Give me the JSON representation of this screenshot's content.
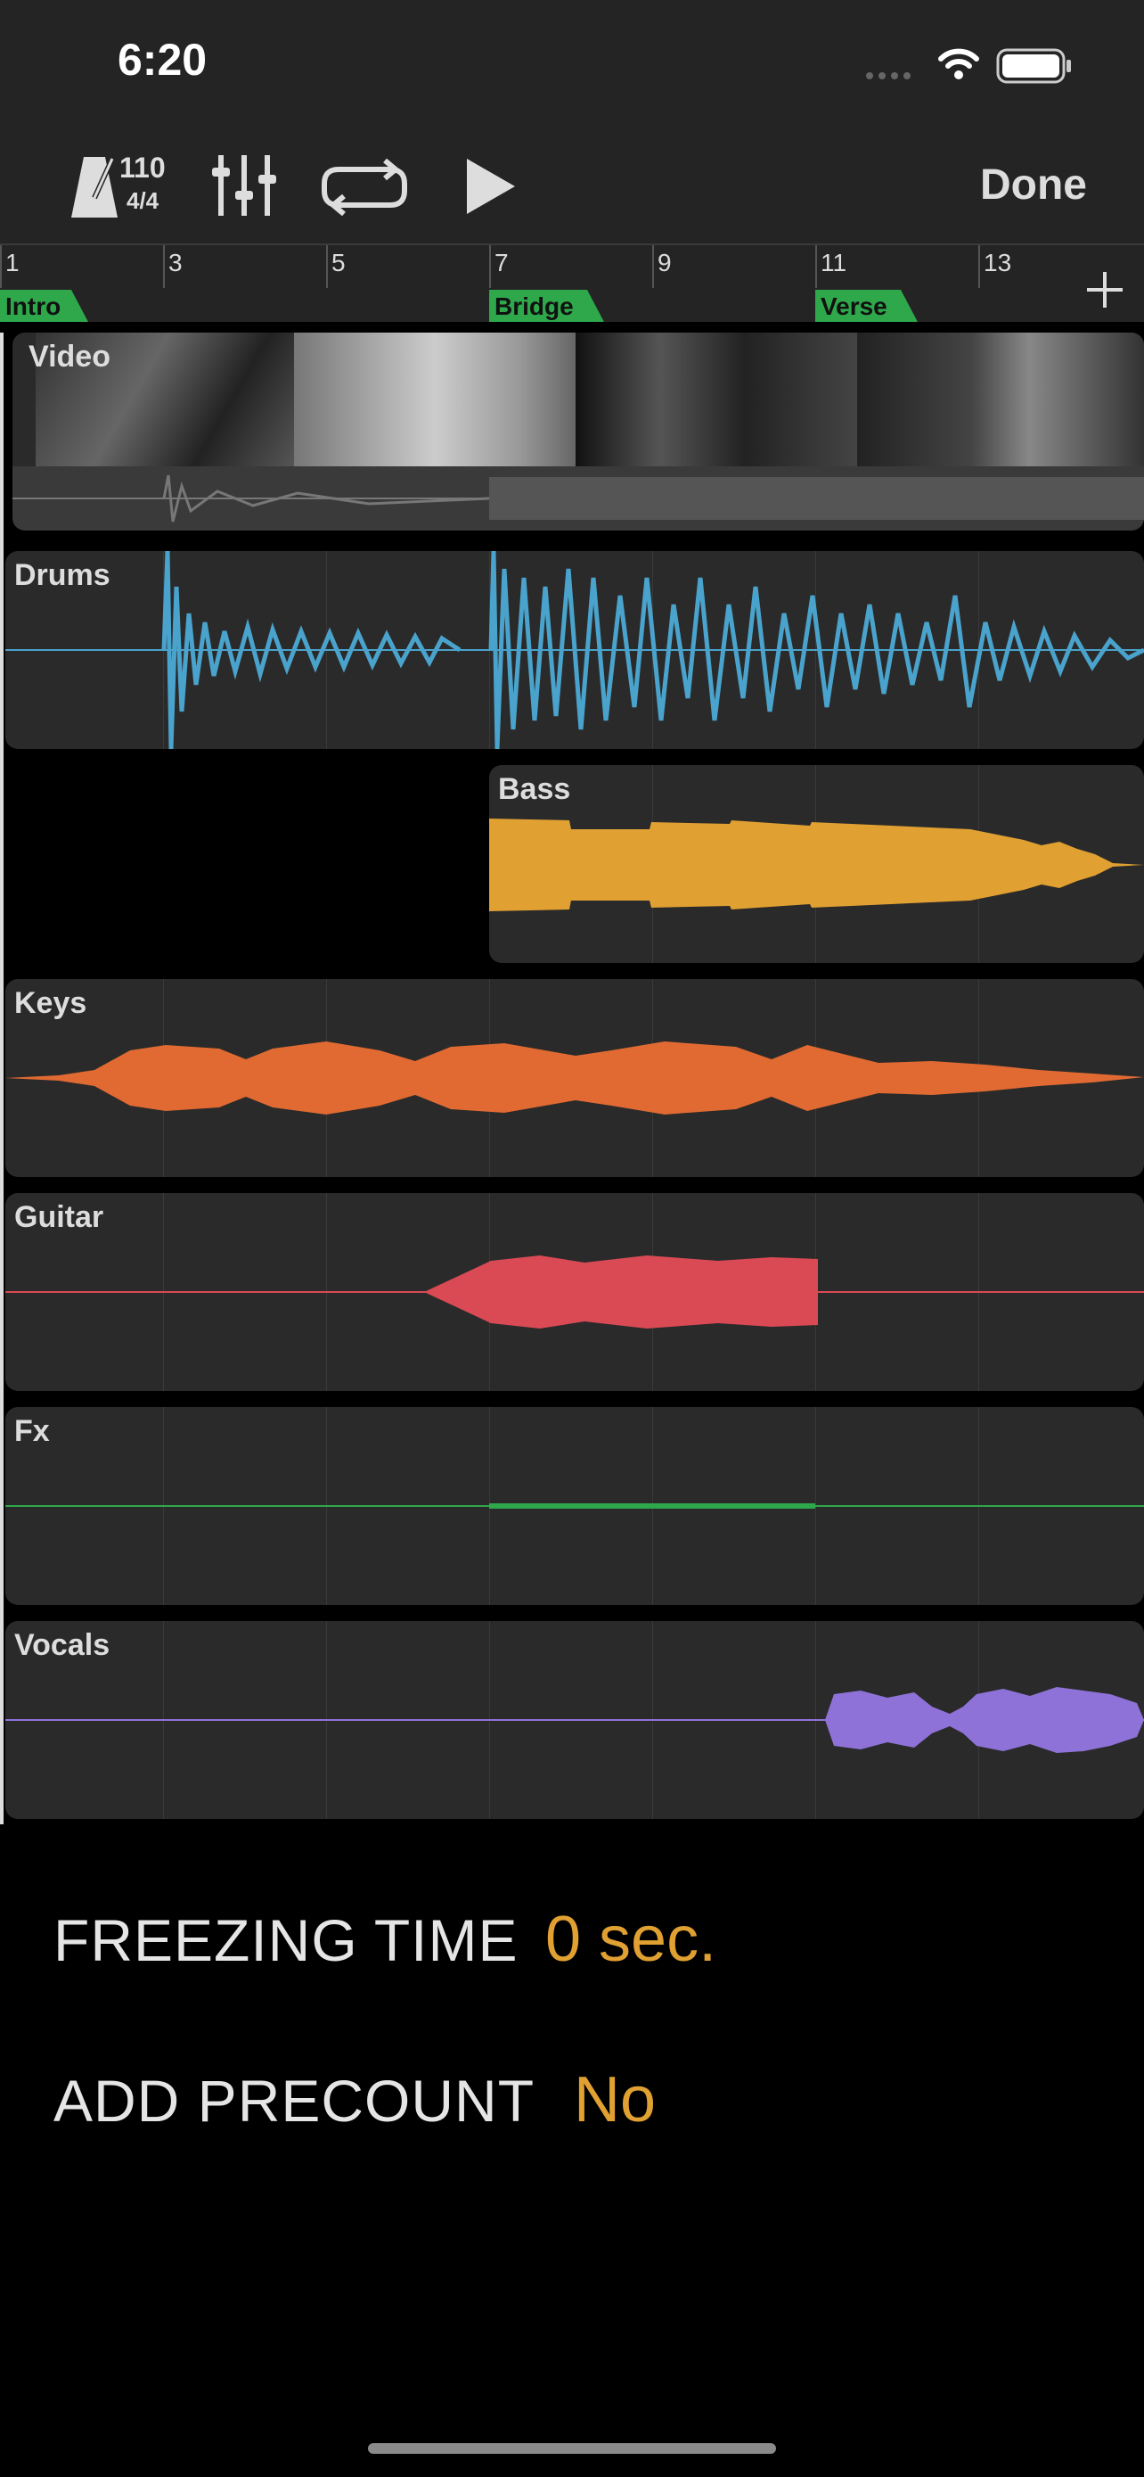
{
  "status": {
    "time": "6:20"
  },
  "toolbar": {
    "tempo": "110",
    "signature": "4/4",
    "done_label": "Done"
  },
  "ruler": {
    "bars": [
      "1",
      "3",
      "5",
      "7",
      "9",
      "11",
      "13"
    ],
    "markers": [
      {
        "label": "Intro"
      },
      {
        "label": "Bridge"
      },
      {
        "label": "Verse"
      }
    ]
  },
  "tracks": [
    {
      "name": "Video",
      "color": "#7a7a7a"
    },
    {
      "name": "Drums",
      "color": "#4aa3cc"
    },
    {
      "name": "Bass",
      "color": "#e0a032"
    },
    {
      "name": "Keys",
      "color": "#e06a32"
    },
    {
      "name": "Guitar",
      "color": "#d94a55"
    },
    {
      "name": "Fx",
      "color": "#2ea84a"
    },
    {
      "name": "Vocals",
      "color": "#8e72d8"
    }
  ],
  "settings": {
    "freezing_label": "FREEZING TIME",
    "freezing_value": "0 sec.",
    "precount_label": "ADD PRECOUNT",
    "precount_value": "No"
  },
  "colors": {
    "accent": "#e0a032",
    "marker": "#2ea84a"
  }
}
